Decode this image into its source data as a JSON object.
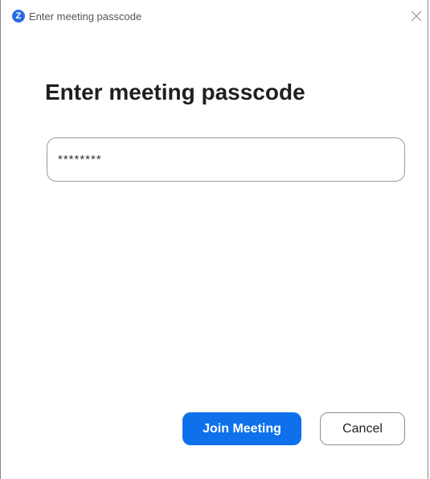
{
  "window": {
    "title": "Enter meeting passcode",
    "app_icon_letter": "Z",
    "app_icon_name": "zoom-logo-icon",
    "close_icon_name": "close-icon"
  },
  "dialog": {
    "heading": "Enter meeting passcode",
    "passcode_value": "********"
  },
  "buttons": {
    "join_label": "Join Meeting",
    "cancel_label": "Cancel"
  },
  "colors": {
    "accent": "#0e71eb",
    "app_icon": "#2d6be4"
  }
}
